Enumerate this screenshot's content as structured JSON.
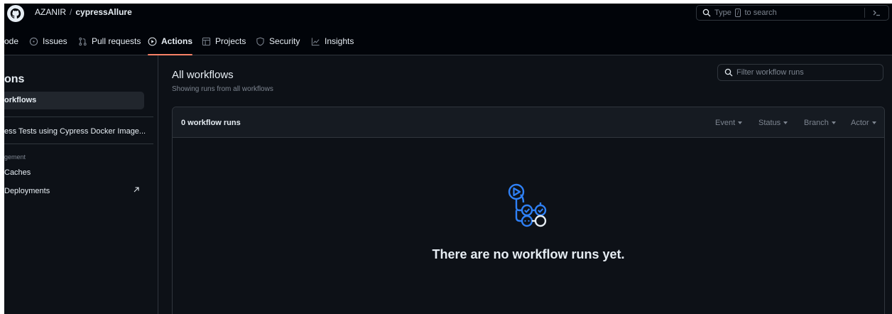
{
  "header": {
    "owner": "AZANIR",
    "separator": "/",
    "repo": "cypressAllure",
    "search": {
      "before": "Type",
      "key": "/",
      "after": "to search"
    }
  },
  "tabs": [
    {
      "label": "ode",
      "icon": "code-icon"
    },
    {
      "label": "Issues",
      "icon": "issue-icon"
    },
    {
      "label": "Pull requests",
      "icon": "pull-request-icon"
    },
    {
      "label": "Actions",
      "icon": "play-icon",
      "selected": true
    },
    {
      "label": "Projects",
      "icon": "table-icon"
    },
    {
      "label": "Security",
      "icon": "shield-icon"
    },
    {
      "label": "Insights",
      "icon": "graph-icon"
    }
  ],
  "sidebar": {
    "title": "ons",
    "all_workflows": "orkflows",
    "workflow": "ess Tests using Cypress Docker Image...",
    "group_label": "gement",
    "caches": "Caches",
    "deployments": "Deployments"
  },
  "main": {
    "title": "All workflows",
    "subtitle": "Showing runs from all workflows",
    "filter_placeholder": "Filter workflow runs",
    "runs_count": "0 workflow runs",
    "filters": [
      "Event",
      "Status",
      "Branch",
      "Actor"
    ],
    "empty_message": "There are no workflow runs yet."
  },
  "colors": {
    "background": "#0d1117",
    "header": "#010409",
    "accent_underline": "#f78166",
    "empty_icon": "#2f81f7"
  }
}
